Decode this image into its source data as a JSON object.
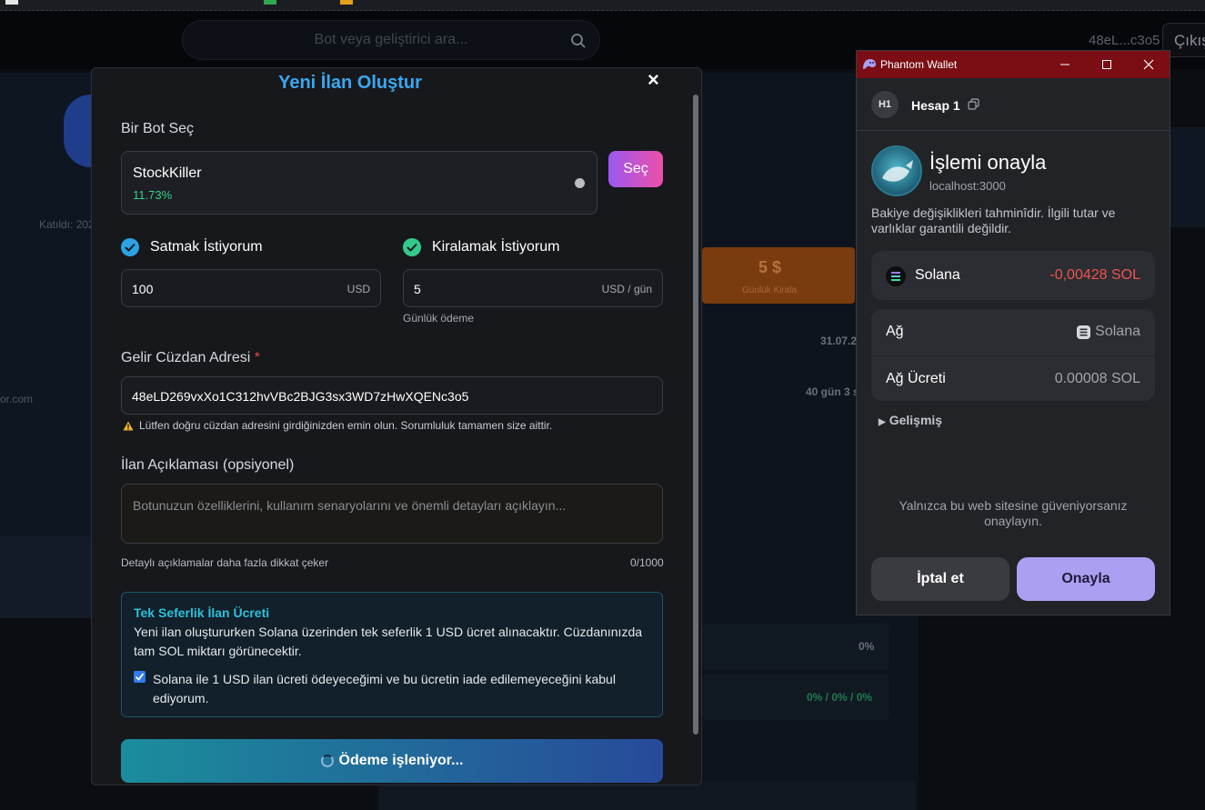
{
  "background": {
    "search_placeholder": "Bot veya geliştirici ara...",
    "user_short": "48eL...c3o5",
    "logout_label": "Çıkış",
    "joined_text": "Katıldı: 202",
    "email_fragment": "or.com",
    "rent_price": "5 $",
    "rent_label": "Günlük Kirala",
    "date_fragment": "31.07.2",
    "duration_fragment": "40 gün 3 s",
    "pct_single": "0%",
    "pct_triple": "0% / 0% / 0%"
  },
  "modal": {
    "title": "Yeni İlan Oluştur",
    "close_symbol": "×",
    "bot_section_label": "Bir Bot Seç",
    "bot_name": "StockKiller",
    "bot_percent": "11.73%",
    "select_button": "Seç",
    "sell_label": "Satmak İstiyorum",
    "rent_label": "Kiralamak İstiyorum",
    "sell_price": "100",
    "sell_unit": "USD",
    "rent_price": "5",
    "rent_unit": "USD / gün",
    "rent_hint": "Günlük ödeme",
    "wallet_label": "Gelir Cüzdan Adresi",
    "required_mark": "*",
    "wallet_address": "48eLD269vxXo1C312hvVBc2BJG3sx3WD7zHwXQENc3o5",
    "wallet_warning": "Lütfen doğru cüzdan adresini girdiğinizden emin olun. Sorumluluk tamamen size aittir.",
    "desc_label": "İlan Açıklaması (opsiyonel)",
    "desc_placeholder": "Botunuzun özelliklerini, kullanım senaryolarını ve önemli detayları açıklayın...",
    "desc_hint": "Detaylı açıklamalar daha fazla dikkat çeker",
    "desc_counter": "0/1000",
    "fee_title": "Tek Seferlik İlan Ücreti",
    "fee_text": "Yeni ilan oluştururken Solana üzerinden tek seferlik 1 USD ücret alınacaktır. Cüzdanınızda tam SOL miktarı görünecektir.",
    "fee_agree": "Solana ile 1 USD ilan ücreti ödeyeceğimi ve bu ücretin iade edilemeyeceğini kabul ediyorum.",
    "pay_button": "Ödeme işleniyor..."
  },
  "wallet": {
    "window_title": "Phantom Wallet",
    "account_initials": "H1",
    "account_name": "Hesap 1",
    "heading": "İşlemi onayla",
    "host": "localhost:3000",
    "estimate_warning": "Bakiye değişiklikleri tahminîdir. İlgili tutar ve varlıklar garantili değildir.",
    "asset_name": "Solana",
    "asset_change": "-0,00428 SOL",
    "network_label": "Ağ",
    "network_value": "Solana",
    "fee_label": "Ağ Ücreti",
    "fee_value": "0.00008 SOL",
    "advanced_label": "Gelişmiş",
    "trust_text": "Yalnızca bu web sitesine güveniyorsanız onaylayın.",
    "cancel_button": "İptal et",
    "confirm_button": "Onayla"
  },
  "colors": {
    "accent_blue": "#3aa7f0",
    "success_green": "#2fd38a",
    "danger_red": "#e0484d",
    "phantom_purple": "#ab9ff2"
  }
}
